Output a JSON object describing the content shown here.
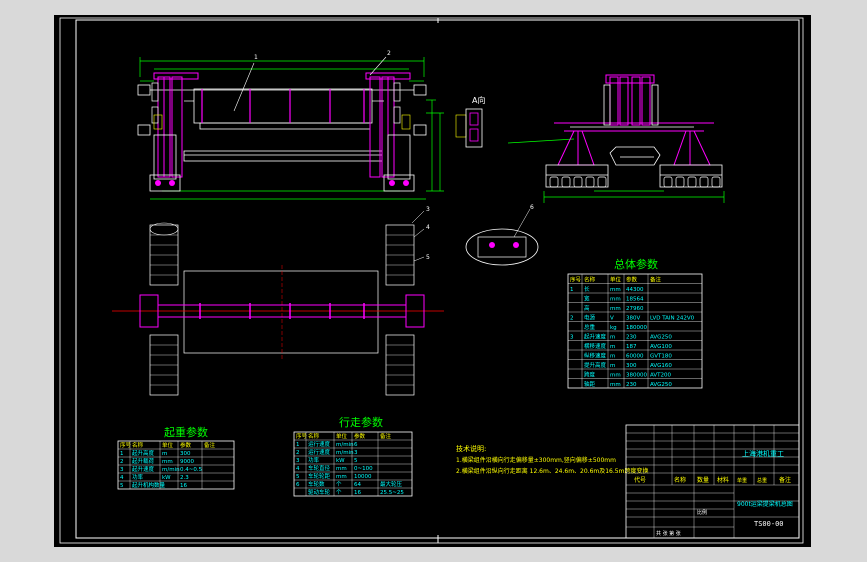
{
  "drawing": {
    "section_lifting_title": "起重参数",
    "section_travel_title": "行走参数",
    "section_general_title": "总体参数",
    "view_label_A": "A向",
    "balloons": [
      "1",
      "2",
      "3",
      "4",
      "5",
      "6"
    ],
    "notes_title": "技术说明:",
    "notes": [
      "1.横梁组件沿横向行走偏移量±300mm,竖向偏移±500mm",
      "2.横梁组件沿纵向行走距离 12.6m、24.6m、20.6m及16.5m跨度变换"
    ]
  },
  "lifting_table": {
    "headers": [
      "序号",
      "名称",
      "单位",
      "参数",
      "备注"
    ],
    "rows": [
      [
        "1",
        "起升高度",
        "m",
        "300",
        ""
      ],
      [
        "2",
        "起升载荷",
        "mm",
        "9000",
        ""
      ],
      [
        "3",
        "起升速度",
        "m/min",
        "0.4~0.5",
        ""
      ],
      [
        "4",
        "功率",
        "kW",
        "2.3",
        ""
      ],
      [
        "5",
        "起升机构数量",
        "",
        "16",
        ""
      ]
    ]
  },
  "travel_table": {
    "headers": [
      "序号",
      "名称",
      "单位",
      "参数",
      "备注"
    ],
    "rows": [
      [
        "1",
        "运行速度",
        "m/min",
        "6",
        ""
      ],
      [
        "2",
        "运行速度",
        "m/min",
        "3",
        ""
      ],
      [
        "3",
        "功率",
        "kW",
        "5",
        ""
      ],
      [
        "4",
        "车轮直径",
        "mm",
        "0~100",
        ""
      ],
      [
        "5",
        "车轮轮距",
        "mm",
        "10000",
        ""
      ],
      [
        "6",
        "车轮数",
        "个",
        "64",
        "最大轮压"
      ],
      [
        "",
        "驱动车轮",
        "个",
        "16",
        "25.5~25"
      ]
    ]
  },
  "general_table": {
    "headers": [
      "序号",
      "名称",
      "单位",
      "参数",
      "备注"
    ],
    "rows": [
      [
        "1",
        "长",
        "mm",
        "44300",
        ""
      ],
      [
        "",
        "宽",
        "mm",
        "18564",
        ""
      ],
      [
        "",
        "高",
        "mm",
        "27960",
        ""
      ],
      [
        "2",
        "电源",
        "V",
        "380V",
        "LVD TAIN 242V0"
      ],
      [
        "",
        "总重",
        "kg",
        "180000",
        ""
      ],
      [
        "3",
        "起升速度",
        "m",
        "230",
        "AVG250"
      ],
      [
        "",
        "横移速度",
        "m",
        "187",
        "AVG100"
      ],
      [
        "",
        "纵移速度",
        "m",
        "60000",
        "GVT180"
      ],
      [
        "",
        "提升高度",
        "m",
        "300",
        "AVG160"
      ],
      [
        "",
        "跨度",
        "mm",
        "380000",
        "AVT200"
      ],
      [
        "",
        "轴距",
        "mm",
        "230",
        "AVG250"
      ]
    ]
  },
  "title_block": {
    "company": "上海港机重工",
    "drawing_name": "900t运梁提梁机总图",
    "drawing_number": "TS00-00",
    "header_labels": [
      "代号",
      "名称",
      "数量",
      "材料",
      "备注",
      "单重",
      "总重"
    ],
    "scale_label": "比例",
    "sheet_label": "共 张 第 张"
  }
}
